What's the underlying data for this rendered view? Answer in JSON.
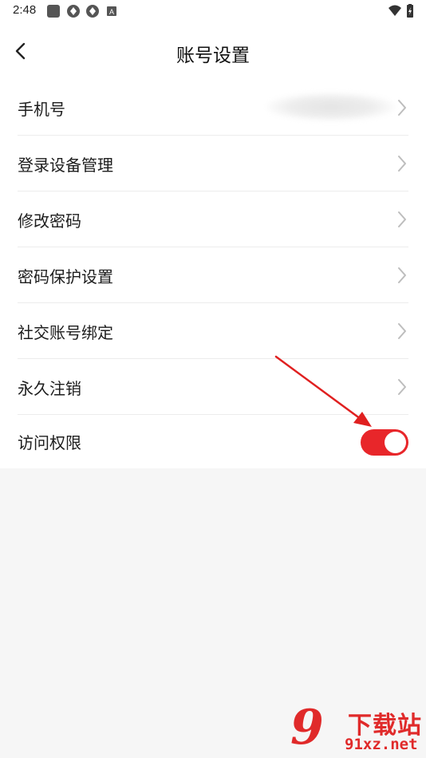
{
  "status_bar": {
    "time": "2:48",
    "left_icons": [
      "app-notification-icon",
      "sync-icon",
      "sync-icon",
      "text-notification-icon"
    ],
    "right_icons": [
      "wifi-icon",
      "battery-icon"
    ]
  },
  "nav": {
    "title": "账号设置",
    "back_icon": "chevron-left-icon"
  },
  "settings": {
    "items": [
      {
        "label": "手机号",
        "value_blurred": true,
        "trailing": "chevron-right-icon"
      },
      {
        "label": "登录设备管理",
        "trailing": "chevron-right-icon"
      },
      {
        "label": "修改密码",
        "trailing": "chevron-right-icon"
      },
      {
        "label": "密码保护设置",
        "trailing": "chevron-right-icon"
      },
      {
        "label": "社交账号绑定",
        "trailing": "chevron-right-icon"
      },
      {
        "label": "永久注销",
        "trailing": "chevron-right-icon"
      },
      {
        "label": "访问权限",
        "trailing": "toggle",
        "toggle_on": true
      }
    ]
  },
  "colors": {
    "accent": "#e8262a",
    "page_background": "#f6f6f6",
    "list_background": "#ffffff",
    "divider": "#ececec",
    "chevron": "#bdbdbd"
  },
  "watermark": {
    "logo": "9",
    "top_text": "下载站",
    "bottom_text": "91xz.net"
  }
}
